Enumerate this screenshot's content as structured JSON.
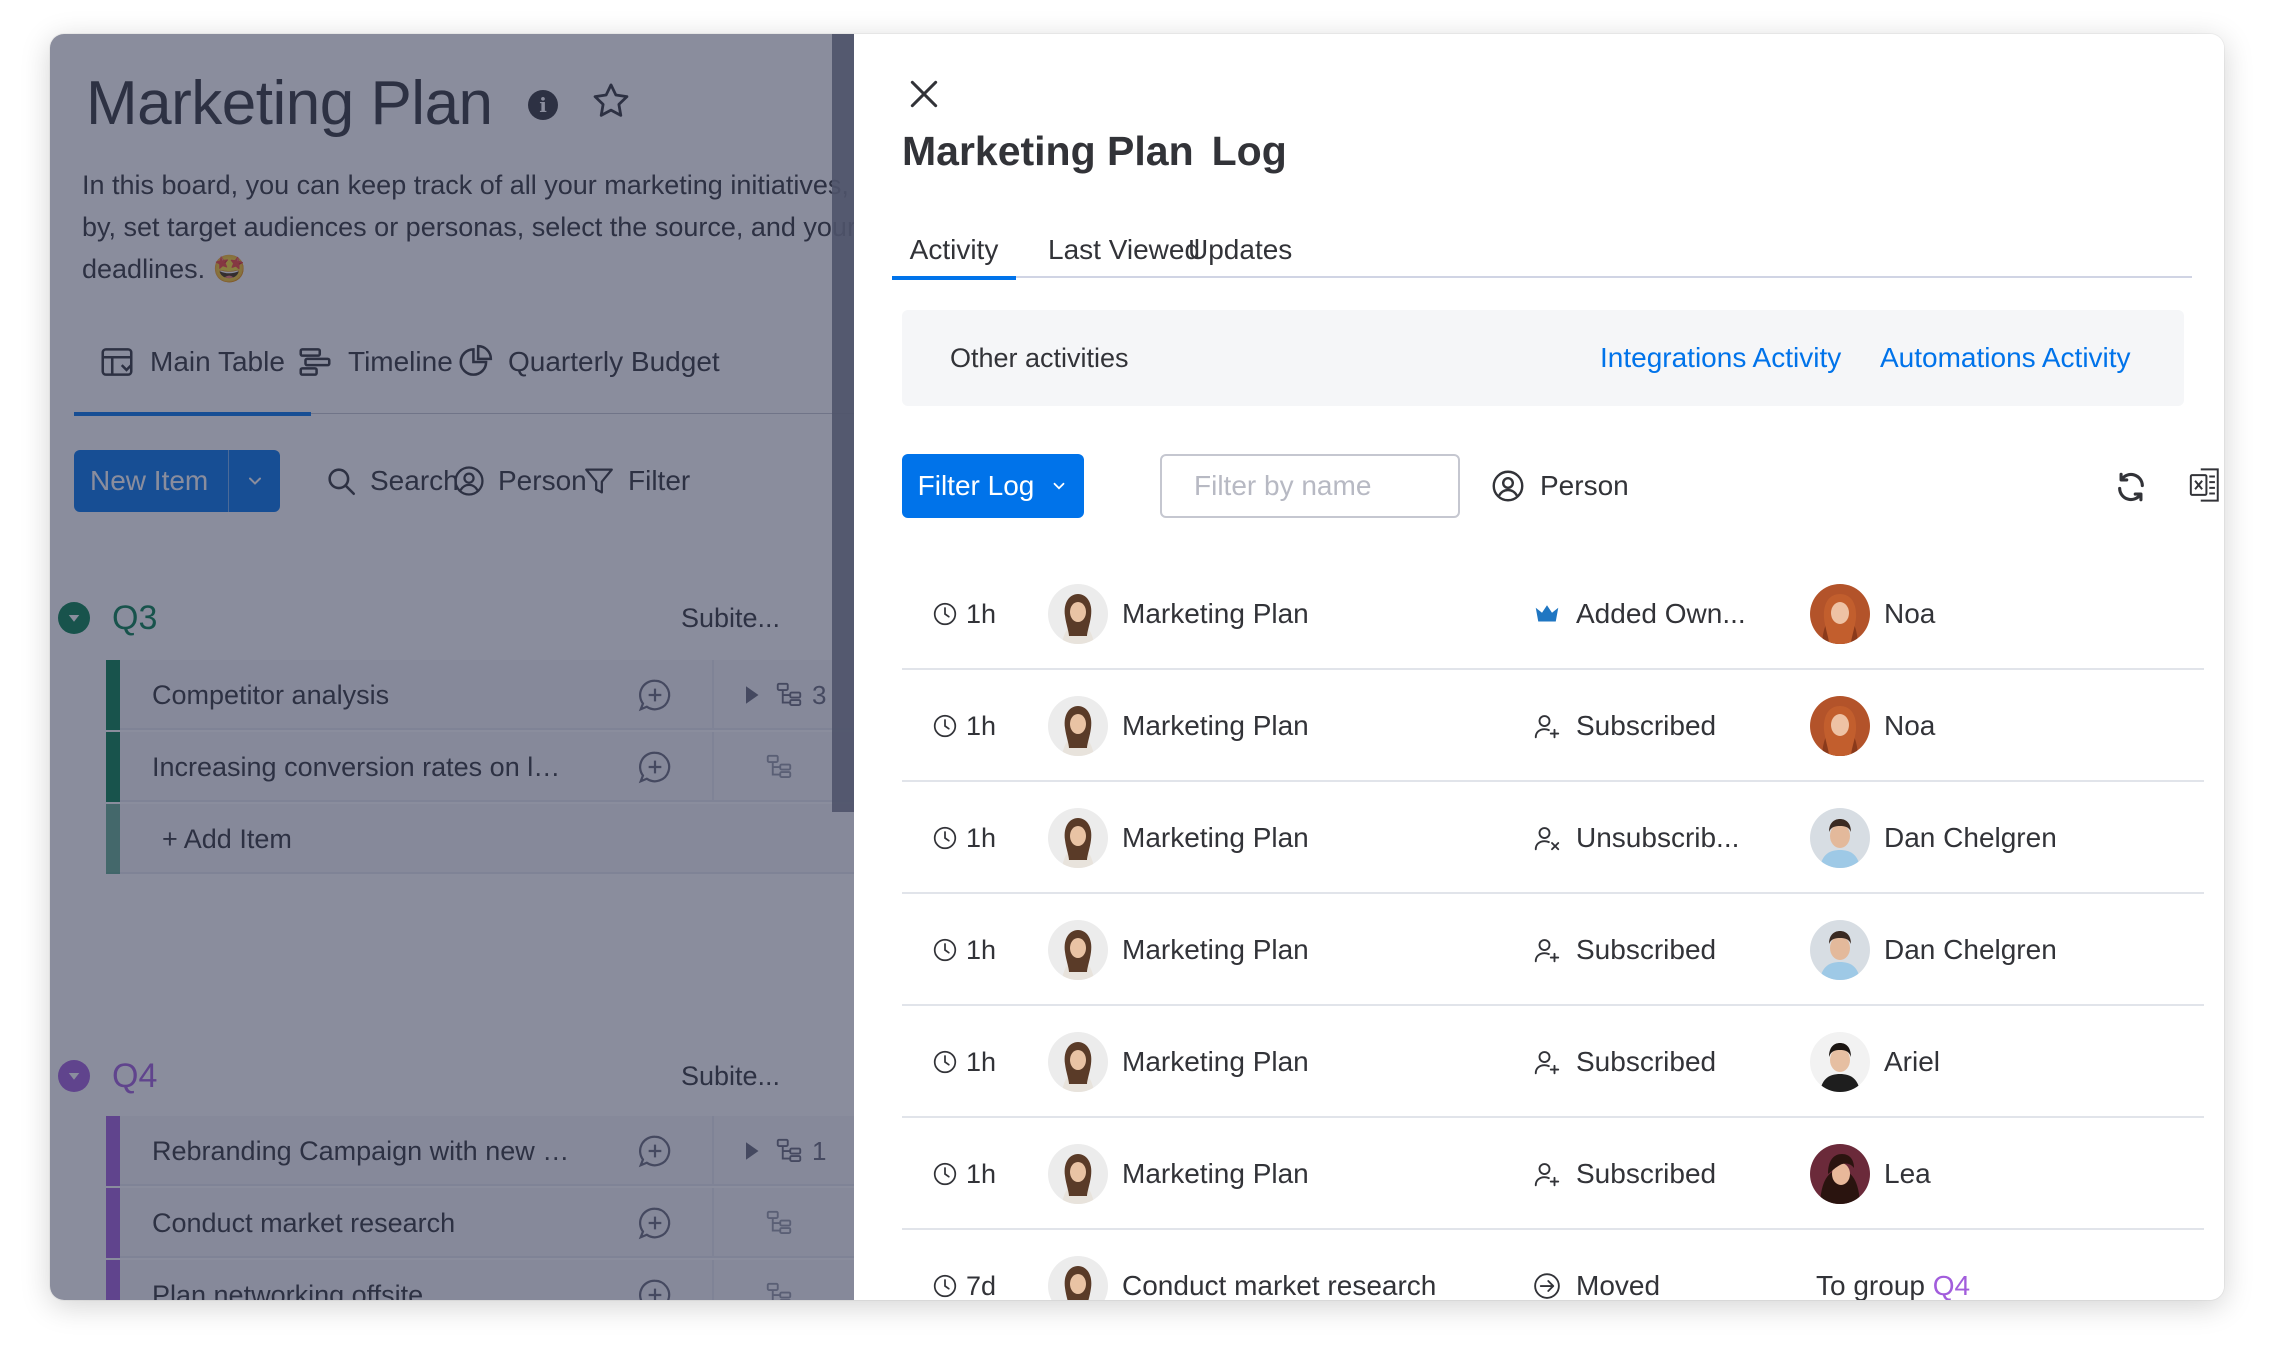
{
  "board": {
    "title": "Marketing Plan",
    "description": "In this board, you can keep track of all your marketing initiatives, measure by, set target audiences or personas, select the source, and your deadlines. 🤩",
    "view_tabs": [
      {
        "label": "Main Table",
        "icon": "table-icon"
      },
      {
        "label": "Timeline",
        "icon": "timeline-icon"
      },
      {
        "label": "Quarterly Budget",
        "icon": "pie-chart-icon"
      }
    ],
    "toolbar": {
      "new_item": "New Item",
      "search": "Search",
      "person": "Person",
      "filter": "Filter"
    },
    "groups": [
      {
        "name": "Q3",
        "color": "#037f4c",
        "subitems_header": "Subite...",
        "items": [
          {
            "name": "Competitor analysis",
            "subitems": "3"
          },
          {
            "name": "Increasing conversion rates on landing pages",
            "subitems": ""
          }
        ],
        "add_item": "+ Add Item"
      },
      {
        "name": "Q4",
        "color": "#a25ddc",
        "subitems_header": "Subite...",
        "items": [
          {
            "name": "Rebranding Campaign with new logo",
            "subitems": "1"
          },
          {
            "name": "Conduct market research",
            "subitems": ""
          },
          {
            "name": "Plan networking offsite",
            "subitems": ""
          }
        ]
      }
    ]
  },
  "panel": {
    "title_board": "Marketing Plan",
    "title_suffix": "Log",
    "tabs": [
      "Activity",
      "Last Viewed",
      "Updates"
    ],
    "other_activities_label": "Other activities",
    "links": [
      "Integrations Activity",
      "Automations Activity"
    ],
    "filter_log": "Filter Log",
    "filter_placeholder": "Filter by name",
    "person": "Person",
    "log": [
      {
        "time": "1h",
        "board": "Marketing Plan",
        "action": "Added Own...",
        "action_icon": "crown-icon",
        "user": "Noa",
        "avatar": "noa"
      },
      {
        "time": "1h",
        "board": "Marketing Plan",
        "action": "Subscribed",
        "action_icon": "user-plus-icon",
        "user": "Noa",
        "avatar": "noa"
      },
      {
        "time": "1h",
        "board": "Marketing Plan",
        "action": "Unsubscrib...",
        "action_icon": "user-remove-icon",
        "user": "Dan Chelgren",
        "avatar": "dan"
      },
      {
        "time": "1h",
        "board": "Marketing Plan",
        "action": "Subscribed",
        "action_icon": "user-plus-icon",
        "user": "Dan Chelgren",
        "avatar": "dan"
      },
      {
        "time": "1h",
        "board": "Marketing Plan",
        "action": "Subscribed",
        "action_icon": "user-plus-icon",
        "user": "Ariel",
        "avatar": "ariel"
      },
      {
        "time": "1h",
        "board": "Marketing Plan",
        "action": "Subscribed",
        "action_icon": "user-plus-icon",
        "user": "Lea",
        "avatar": "lea"
      },
      {
        "time": "7d",
        "board": "Conduct market research",
        "action": "Moved",
        "action_icon": "arrow-circle-icon",
        "dest_prefix": "To group",
        "dest_group": "Q4"
      }
    ]
  }
}
